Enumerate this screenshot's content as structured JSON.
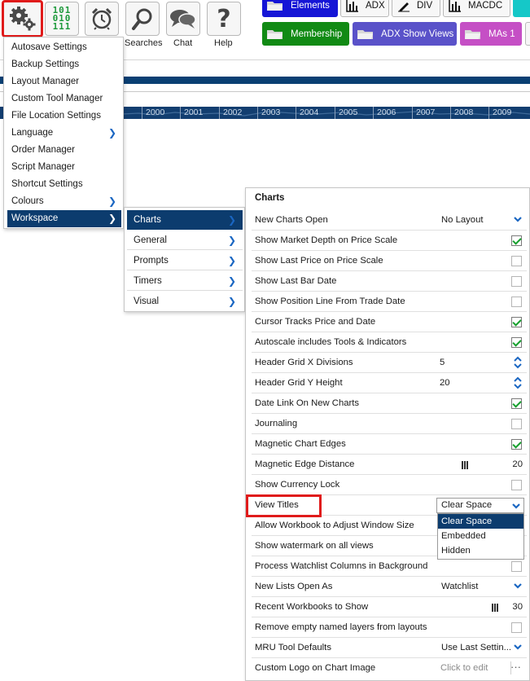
{
  "toolbar": {
    "buttons": [
      {
        "label": "",
        "icon": "settings-gears-icon"
      },
      {
        "label": "",
        "icon": "binary-data-icon",
        "binary_rows": [
          "101",
          "010",
          "111"
        ]
      },
      {
        "label": "",
        "icon": "alarm-clock-icon"
      },
      {
        "label": "Searches",
        "icon": "magnifier-icon"
      },
      {
        "label": "Chat",
        "icon": "chat-bubbles-icon"
      },
      {
        "label": "Help",
        "icon": "question-mark-icon"
      }
    ],
    "workspace_buttons_row1": [
      {
        "label": "Elements",
        "color": "#1515d6",
        "text_color": "#ffffff",
        "icon": "folder-icon"
      },
      {
        "label": "ADX",
        "color": "#f7f7f7",
        "text_color": "#111111",
        "icon": "bar-chart-icon"
      },
      {
        "label": "DIV",
        "color": "#f7f7f7",
        "text_color": "#111111",
        "icon": "pencil-icon"
      },
      {
        "label": "MACDC",
        "color": "#f7f7f7",
        "text_color": "#111111",
        "icon": "bar-chart-icon"
      }
    ],
    "workspace_buttons_row2": [
      {
        "label": "Membership",
        "color": "#118a14",
        "text_color": "#ffffff",
        "icon": "folder-icon"
      },
      {
        "label": "ADX Show Views",
        "color": "#5a52c9",
        "text_color": "#ffffff",
        "icon": "folder-icon"
      },
      {
        "label": "MAs 1",
        "color": "#c54fc5",
        "text_color": "#ffffff",
        "icon": "folder-icon"
      }
    ]
  },
  "timeline": {
    "years": [
      "2000",
      "2001",
      "2002",
      "2003",
      "2004",
      "2005",
      "2006",
      "2007",
      "2008",
      "2009"
    ]
  },
  "settings_menu": {
    "items": [
      {
        "label": "Autosave Settings",
        "submenu": false
      },
      {
        "label": "Backup Settings",
        "submenu": false
      },
      {
        "label": "Layout Manager",
        "submenu": false
      },
      {
        "label": "Custom Tool Manager",
        "submenu": false
      },
      {
        "label": "File Location Settings",
        "submenu": false
      },
      {
        "label": "Language",
        "submenu": true
      },
      {
        "label": "Order Manager",
        "submenu": false
      },
      {
        "label": "Script Manager",
        "submenu": false
      },
      {
        "label": "Shortcut Settings",
        "submenu": false
      },
      {
        "label": "Colours",
        "submenu": true
      },
      {
        "label": "Workspace",
        "submenu": true,
        "active": true
      }
    ]
  },
  "workspace_submenu": {
    "items": [
      {
        "label": "Charts",
        "active": true
      },
      {
        "label": "General"
      },
      {
        "label": "Prompts"
      },
      {
        "label": "Timers"
      },
      {
        "label": "Visual"
      }
    ]
  },
  "charts_panel": {
    "title": "Charts",
    "rows": [
      {
        "label": "New Charts Open",
        "type": "dropdown",
        "value": "No Layout"
      },
      {
        "label": "Show Market Depth on Price Scale",
        "type": "checkbox",
        "checked": true
      },
      {
        "label": "Show Last Price on Price Scale",
        "type": "checkbox",
        "checked": false
      },
      {
        "label": "Show Last Bar Date",
        "type": "checkbox",
        "checked": false
      },
      {
        "label": "Show Position Line From Trade Date",
        "type": "checkbox",
        "checked": false
      },
      {
        "label": "Cursor Tracks Price and Date",
        "type": "checkbox",
        "checked": true
      },
      {
        "label": "Autoscale includes Tools & Indicators",
        "type": "checkbox",
        "checked": true
      },
      {
        "label": "Header Grid X Divisions",
        "type": "spinner",
        "value": "5"
      },
      {
        "label": "Header Grid Y Height",
        "type": "spinner",
        "value": "20"
      },
      {
        "label": "Date Link On New Charts",
        "type": "checkbox",
        "checked": true
      },
      {
        "label": "Journaling",
        "type": "checkbox",
        "checked": false
      },
      {
        "label": "Magnetic Chart Edges",
        "type": "checkbox",
        "checked": true
      },
      {
        "label": "Magnetic Edge Distance",
        "type": "slider",
        "value": "20"
      },
      {
        "label": "Show Currency Lock",
        "type": "checkbox",
        "checked": false
      },
      {
        "label": "View Titles",
        "type": "dropdown-open",
        "value": "Clear Space"
      },
      {
        "label": "Allow Workbook to Adjust Window Size",
        "type": "hidden"
      },
      {
        "label": "Show watermark on all views",
        "type": "hidden"
      },
      {
        "label": "Process Watchlist Columns in Background",
        "type": "checkbox",
        "checked": false
      },
      {
        "label": "New Lists Open As",
        "type": "dropdown",
        "value": "Watchlist"
      },
      {
        "label": "Recent Workbooks to Show",
        "type": "slider",
        "value": "30"
      },
      {
        "label": "Remove empty named layers from layouts",
        "type": "checkbox",
        "checked": false
      },
      {
        "label": "MRU Tool Defaults",
        "type": "dropdown",
        "value": "Use Last Settin..."
      },
      {
        "label": "Custom Logo on Chart Image",
        "type": "edit",
        "value": "Click to edit",
        "more": "···"
      }
    ],
    "view_titles_options": [
      "Clear Space",
      "Embedded",
      "Hidden"
    ],
    "view_titles_selected": "Clear Space"
  },
  "colors": {
    "accent_navy": "#0c3c6e",
    "highlight_red": "#e01b1b",
    "check_green": "#17a02e",
    "chevron_blue": "#1a66c2"
  }
}
